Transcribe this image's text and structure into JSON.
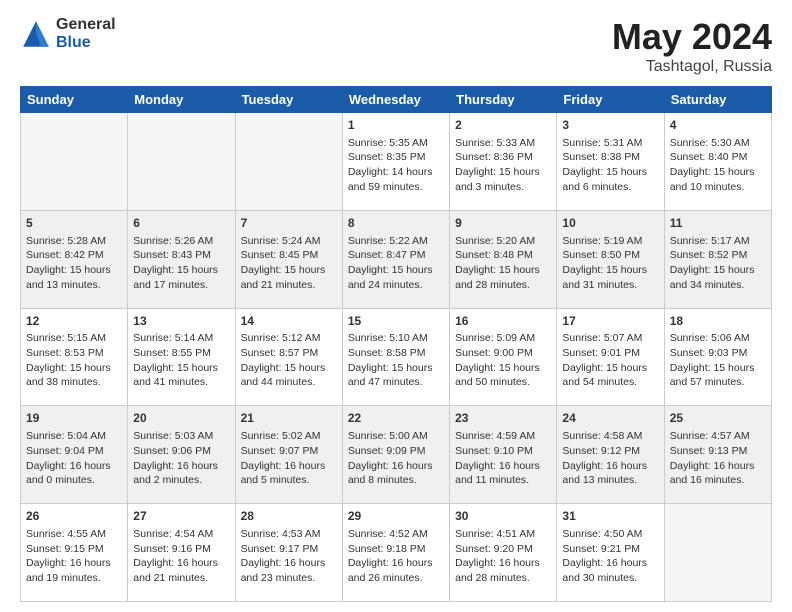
{
  "logo": {
    "general": "General",
    "blue": "Blue"
  },
  "title": {
    "month_year": "May 2024",
    "location": "Tashtagol, Russia"
  },
  "days_of_week": [
    "Sunday",
    "Monday",
    "Tuesday",
    "Wednesday",
    "Thursday",
    "Friday",
    "Saturday"
  ],
  "weeks": [
    {
      "shade": false,
      "days": [
        {
          "num": "",
          "info": ""
        },
        {
          "num": "",
          "info": ""
        },
        {
          "num": "",
          "info": ""
        },
        {
          "num": "1",
          "info": "Sunrise: 5:35 AM\nSunset: 8:35 PM\nDaylight: 14 hours\nand 59 minutes."
        },
        {
          "num": "2",
          "info": "Sunrise: 5:33 AM\nSunset: 8:36 PM\nDaylight: 15 hours\nand 3 minutes."
        },
        {
          "num": "3",
          "info": "Sunrise: 5:31 AM\nSunset: 8:38 PM\nDaylight: 15 hours\nand 6 minutes."
        },
        {
          "num": "4",
          "info": "Sunrise: 5:30 AM\nSunset: 8:40 PM\nDaylight: 15 hours\nand 10 minutes."
        }
      ]
    },
    {
      "shade": true,
      "days": [
        {
          "num": "5",
          "info": "Sunrise: 5:28 AM\nSunset: 8:42 PM\nDaylight: 15 hours\nand 13 minutes."
        },
        {
          "num": "6",
          "info": "Sunrise: 5:26 AM\nSunset: 8:43 PM\nDaylight: 15 hours\nand 17 minutes."
        },
        {
          "num": "7",
          "info": "Sunrise: 5:24 AM\nSunset: 8:45 PM\nDaylight: 15 hours\nand 21 minutes."
        },
        {
          "num": "8",
          "info": "Sunrise: 5:22 AM\nSunset: 8:47 PM\nDaylight: 15 hours\nand 24 minutes."
        },
        {
          "num": "9",
          "info": "Sunrise: 5:20 AM\nSunset: 8:48 PM\nDaylight: 15 hours\nand 28 minutes."
        },
        {
          "num": "10",
          "info": "Sunrise: 5:19 AM\nSunset: 8:50 PM\nDaylight: 15 hours\nand 31 minutes."
        },
        {
          "num": "11",
          "info": "Sunrise: 5:17 AM\nSunset: 8:52 PM\nDaylight: 15 hours\nand 34 minutes."
        }
      ]
    },
    {
      "shade": false,
      "days": [
        {
          "num": "12",
          "info": "Sunrise: 5:15 AM\nSunset: 8:53 PM\nDaylight: 15 hours\nand 38 minutes."
        },
        {
          "num": "13",
          "info": "Sunrise: 5:14 AM\nSunset: 8:55 PM\nDaylight: 15 hours\nand 41 minutes."
        },
        {
          "num": "14",
          "info": "Sunrise: 5:12 AM\nSunset: 8:57 PM\nDaylight: 15 hours\nand 44 minutes."
        },
        {
          "num": "15",
          "info": "Sunrise: 5:10 AM\nSunset: 8:58 PM\nDaylight: 15 hours\nand 47 minutes."
        },
        {
          "num": "16",
          "info": "Sunrise: 5:09 AM\nSunset: 9:00 PM\nDaylight: 15 hours\nand 50 minutes."
        },
        {
          "num": "17",
          "info": "Sunrise: 5:07 AM\nSunset: 9:01 PM\nDaylight: 15 hours\nand 54 minutes."
        },
        {
          "num": "18",
          "info": "Sunrise: 5:06 AM\nSunset: 9:03 PM\nDaylight: 15 hours\nand 57 minutes."
        }
      ]
    },
    {
      "shade": true,
      "days": [
        {
          "num": "19",
          "info": "Sunrise: 5:04 AM\nSunset: 9:04 PM\nDaylight: 16 hours\nand 0 minutes."
        },
        {
          "num": "20",
          "info": "Sunrise: 5:03 AM\nSunset: 9:06 PM\nDaylight: 16 hours\nand 2 minutes."
        },
        {
          "num": "21",
          "info": "Sunrise: 5:02 AM\nSunset: 9:07 PM\nDaylight: 16 hours\nand 5 minutes."
        },
        {
          "num": "22",
          "info": "Sunrise: 5:00 AM\nSunset: 9:09 PM\nDaylight: 16 hours\nand 8 minutes."
        },
        {
          "num": "23",
          "info": "Sunrise: 4:59 AM\nSunset: 9:10 PM\nDaylight: 16 hours\nand 11 minutes."
        },
        {
          "num": "24",
          "info": "Sunrise: 4:58 AM\nSunset: 9:12 PM\nDaylight: 16 hours\nand 13 minutes."
        },
        {
          "num": "25",
          "info": "Sunrise: 4:57 AM\nSunset: 9:13 PM\nDaylight: 16 hours\nand 16 minutes."
        }
      ]
    },
    {
      "shade": false,
      "days": [
        {
          "num": "26",
          "info": "Sunrise: 4:55 AM\nSunset: 9:15 PM\nDaylight: 16 hours\nand 19 minutes."
        },
        {
          "num": "27",
          "info": "Sunrise: 4:54 AM\nSunset: 9:16 PM\nDaylight: 16 hours\nand 21 minutes."
        },
        {
          "num": "28",
          "info": "Sunrise: 4:53 AM\nSunset: 9:17 PM\nDaylight: 16 hours\nand 23 minutes."
        },
        {
          "num": "29",
          "info": "Sunrise: 4:52 AM\nSunset: 9:18 PM\nDaylight: 16 hours\nand 26 minutes."
        },
        {
          "num": "30",
          "info": "Sunrise: 4:51 AM\nSunset: 9:20 PM\nDaylight: 16 hours\nand 28 minutes."
        },
        {
          "num": "31",
          "info": "Sunrise: 4:50 AM\nSunset: 9:21 PM\nDaylight: 16 hours\nand 30 minutes."
        },
        {
          "num": "",
          "info": ""
        }
      ]
    }
  ]
}
